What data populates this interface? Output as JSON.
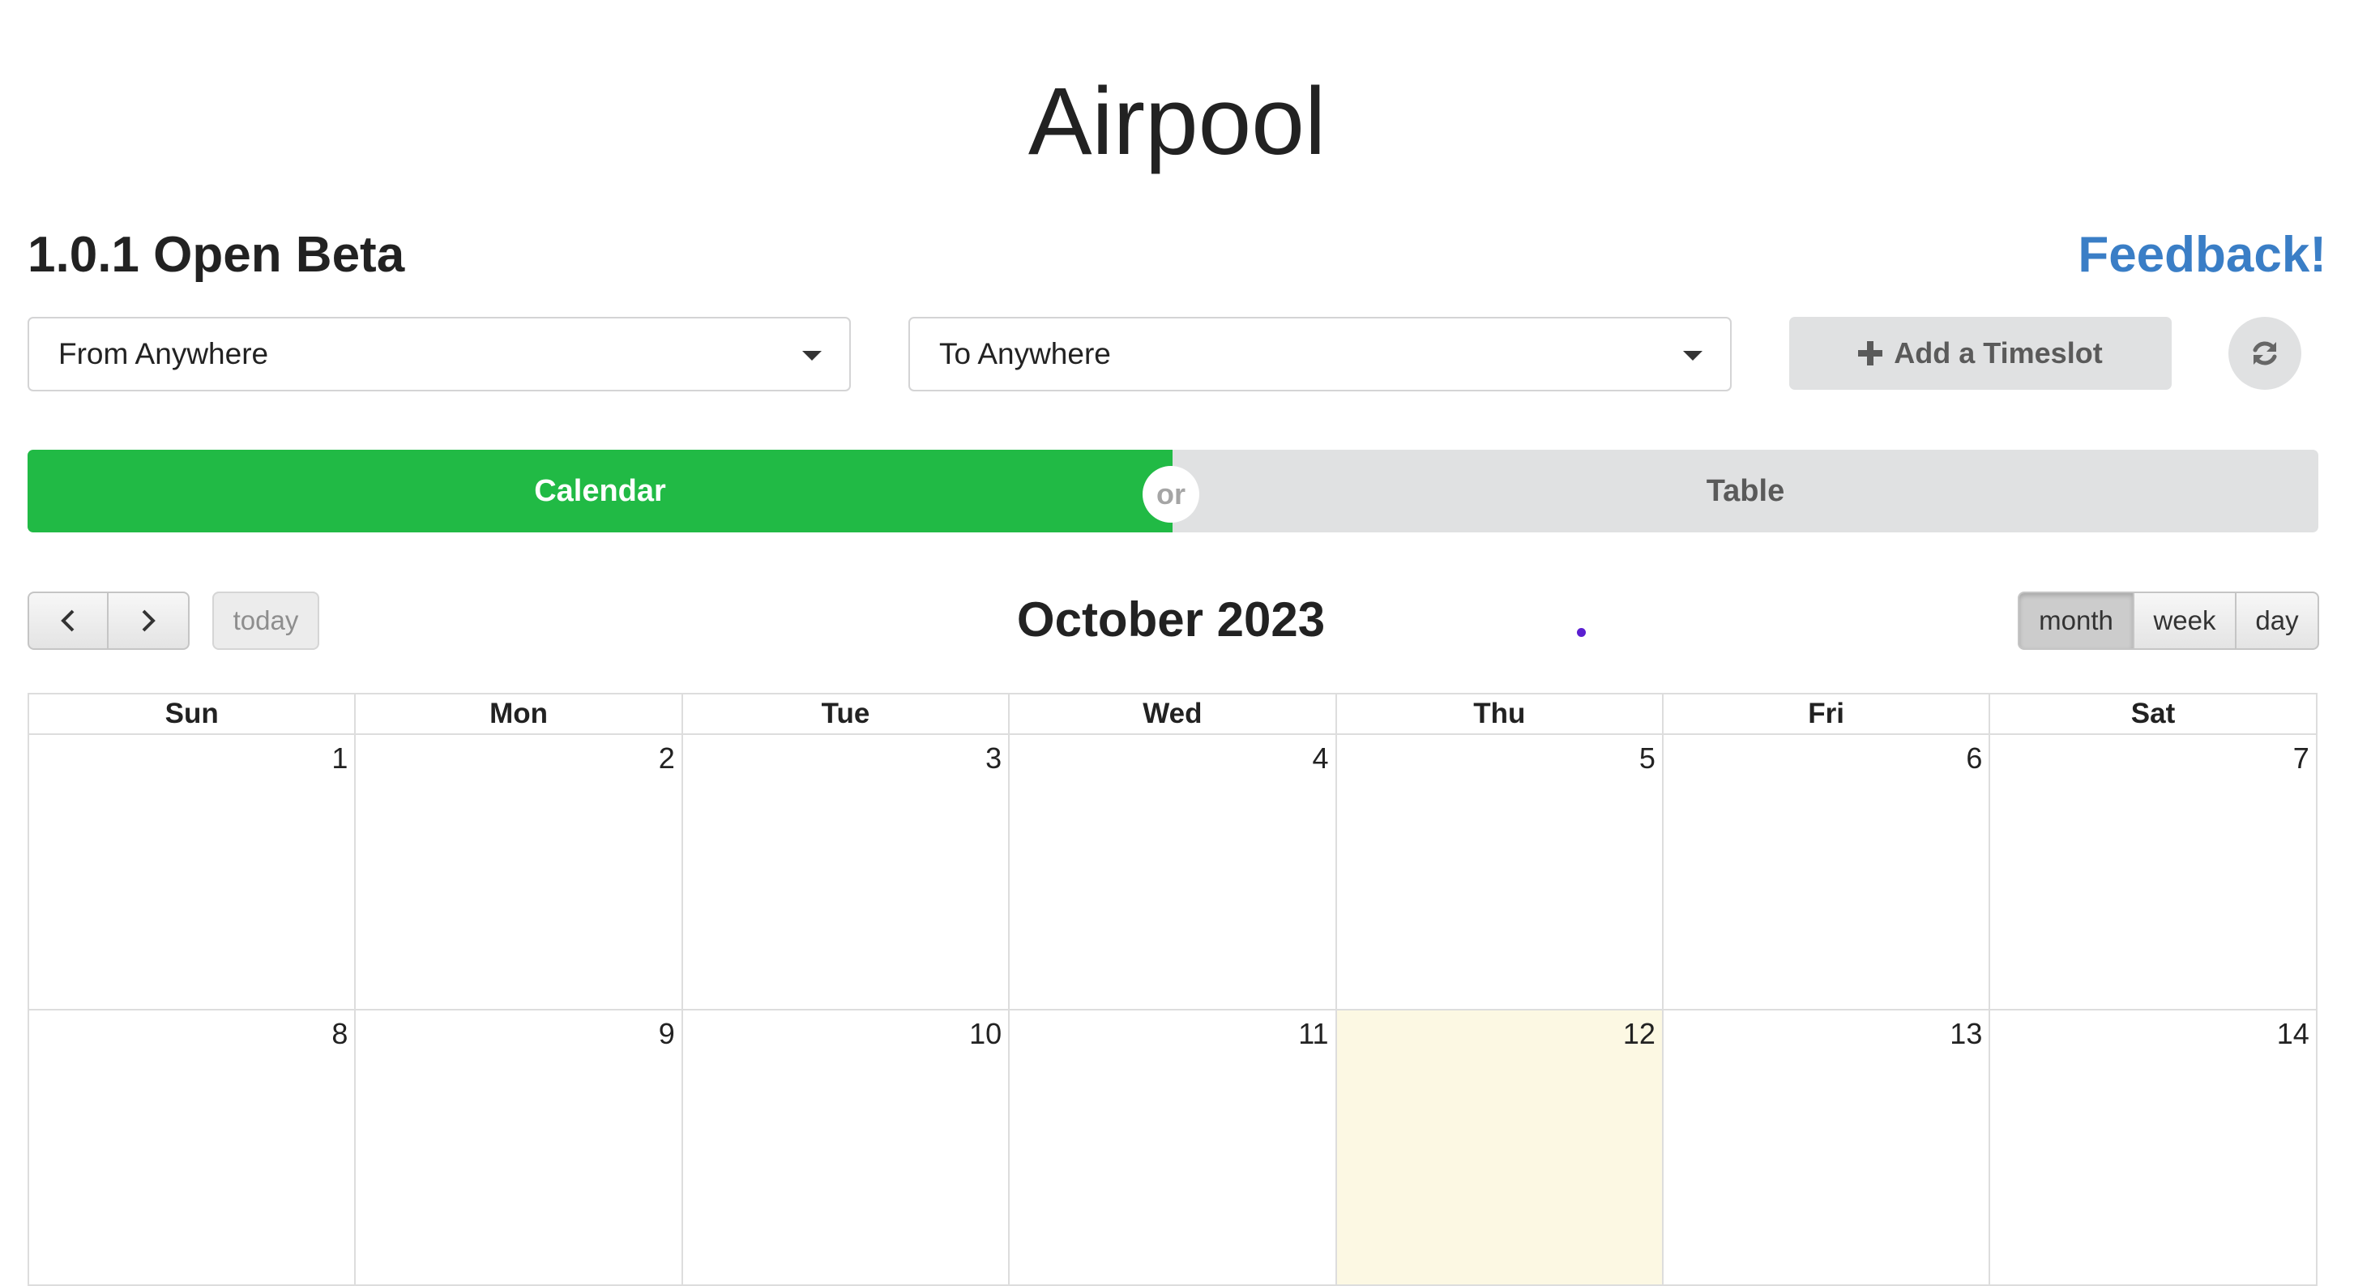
{
  "app": {
    "title": "Airpool",
    "version": "1.0.1 Open Beta",
    "feedback_link": "Feedback!"
  },
  "filters": {
    "from": {
      "value": "From Anywhere"
    },
    "to": {
      "value": "To Anywhere"
    },
    "add_timeslot_label": "Add a Timeslot",
    "refresh_icon": "refresh-icon"
  },
  "toggle": {
    "calendar_label": "Calendar",
    "or_label": "or",
    "table_label": "Table",
    "active": "Calendar",
    "active_color": "#21ba45"
  },
  "calendar": {
    "title": "October 2023",
    "today_label": "today",
    "views": [
      "month",
      "week",
      "day"
    ],
    "active_view": "month",
    "weekdays": [
      "Sun",
      "Mon",
      "Tue",
      "Wed",
      "Thu",
      "Fri",
      "Sat"
    ],
    "weeks": [
      [
        "1",
        "2",
        "3",
        "4",
        "5",
        "6",
        "7"
      ],
      [
        "8",
        "9",
        "10",
        "11",
        "12",
        "13",
        "14"
      ]
    ],
    "today_date": "12",
    "today_highlight_color": "#fcf8e3"
  },
  "colors": {
    "link": "#3a7ec6",
    "button_gray": "#e0e1e2"
  }
}
